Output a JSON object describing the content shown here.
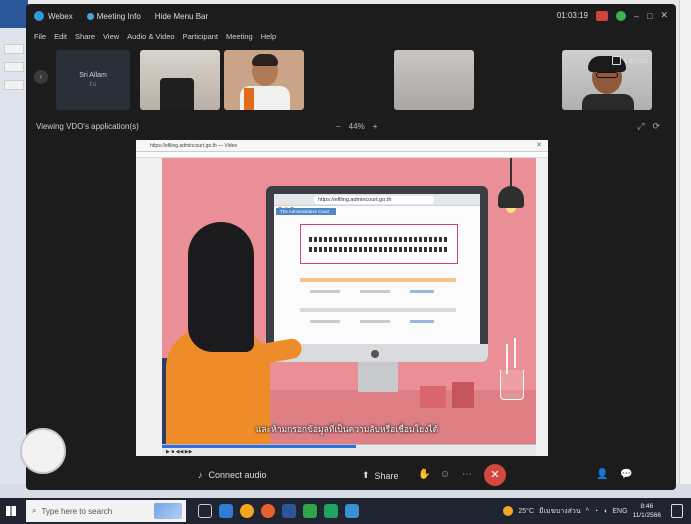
{
  "titlebar": {
    "app_name": "Webex",
    "meeting_info": "Meeting Info",
    "hide_menu": "Hide Menu Bar",
    "timer": "01:03:19"
  },
  "menubar": [
    "File",
    "Edit",
    "Share",
    "View",
    "Audio & Video",
    "Participant",
    "Meeting",
    "Help"
  ],
  "participants": {
    "name_tile_name": "Sri Allam",
    "name_tile_sub": "f.s",
    "layout_label": "Layout"
  },
  "viewing": {
    "label": "Viewing VDO's application(s)",
    "zoom": "44%",
    "zoom_minus": "−",
    "zoom_plus": "+"
  },
  "shared": {
    "window_title": "https://efiling.admincourt.go.th — Video",
    "url": "https://efiling.admincourt.go.th",
    "site_tab": "The Administrative Court",
    "subtitle": "และห้ามกรอกข้อมูลที่เป็นความลับหรือเชื่อมโยงได้"
  },
  "controls": {
    "connect_audio": "Connect audio",
    "share": "Share"
  },
  "taskbar": {
    "search_placeholder": "Type here to search",
    "weather": "25°C",
    "weather_desc": "มีเมฆบางส่วน",
    "lang": "ENG",
    "time": "8:46",
    "date": "11/1/2566"
  }
}
